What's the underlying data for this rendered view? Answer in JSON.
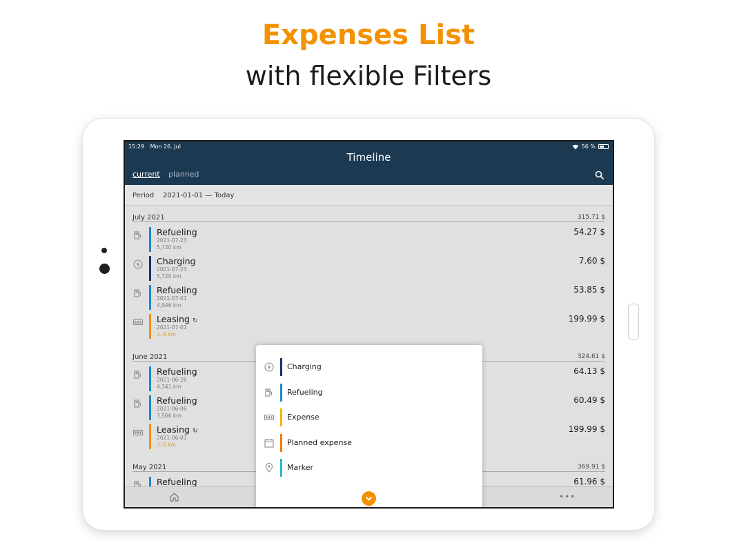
{
  "headline": {
    "line1": "Expenses List",
    "line2": "with flexible Filters"
  },
  "status": {
    "time": "15:29",
    "date": "Mon 26. Jul",
    "battery": "56 %"
  },
  "appbar": {
    "title": "Timeline",
    "tab_current": "current",
    "tab_planned": "planned",
    "search_icon": "search-icon"
  },
  "period": {
    "label": "Period",
    "value": "2021-01-01 — Today"
  },
  "months": [
    {
      "name": "July 2021",
      "total": "315.71 $",
      "items": [
        {
          "title": "Refueling",
          "date": "2021-07-23",
          "km": "5,720 km",
          "amount": "54.27 $",
          "icon": "fuel-pump-icon",
          "color": "#1e88c8"
        },
        {
          "title": "Charging",
          "date": "2021-07-23",
          "km": "5,720 km",
          "amount": "7.60 $",
          "icon": "lightning-icon",
          "color": "#1b2f6b"
        },
        {
          "title": "Refueling",
          "date": "2021-07-01",
          "km": "4,946 km",
          "amount": "53.85 $",
          "icon": "fuel-pump-icon",
          "color": "#1e88c8"
        },
        {
          "title": "Leasing",
          "recurring": "↻",
          "date": "2021-07-01",
          "km": "⚠ 0 km",
          "amount": "199.99 $",
          "icon": "expense-icon",
          "color": "#f39200",
          "warn": true
        }
      ]
    },
    {
      "name": "June 2021",
      "total": "324.61 $",
      "items": [
        {
          "title": "Refueling",
          "date": "2021-06-26",
          "km": "4,341 km",
          "amount": "64.13 $",
          "icon": "fuel-pump-icon",
          "color": "#1e88c8"
        },
        {
          "title": "Refueling",
          "date": "2021-06-06",
          "km": "3,566 km",
          "amount": "60.49 $",
          "icon": "fuel-pump-icon",
          "color": "#1e88c8"
        },
        {
          "title": "Leasing",
          "recurring": "↻",
          "date": "2021-06-01",
          "km": "⚠ 0 km",
          "amount": "199.99 $",
          "icon": "expense-icon",
          "color": "#f39200",
          "warn": true
        }
      ]
    },
    {
      "name": "May 2021",
      "total": "369.91 $",
      "items": [
        {
          "title": "Refueling",
          "amount": "61.96 $",
          "icon": "fuel-pump-icon",
          "color": "#1e88c8"
        }
      ]
    }
  ],
  "filter_menu": [
    {
      "label": "Charging",
      "icon": "lightning-icon",
      "color": "#1b2f6b"
    },
    {
      "label": "Refueling",
      "icon": "fuel-pump-icon",
      "color": "#1e88c8"
    },
    {
      "label": "Expense",
      "icon": "expense-icon",
      "color": "#f5b400"
    },
    {
      "label": "Planned expense",
      "icon": "calendar-icon",
      "color": "#ef7d00"
    },
    {
      "label": "Marker",
      "icon": "location-pin-icon",
      "color": "#26b5d9"
    }
  ],
  "colors": {
    "accent": "#f39200",
    "appbar": "#1b3a52"
  }
}
